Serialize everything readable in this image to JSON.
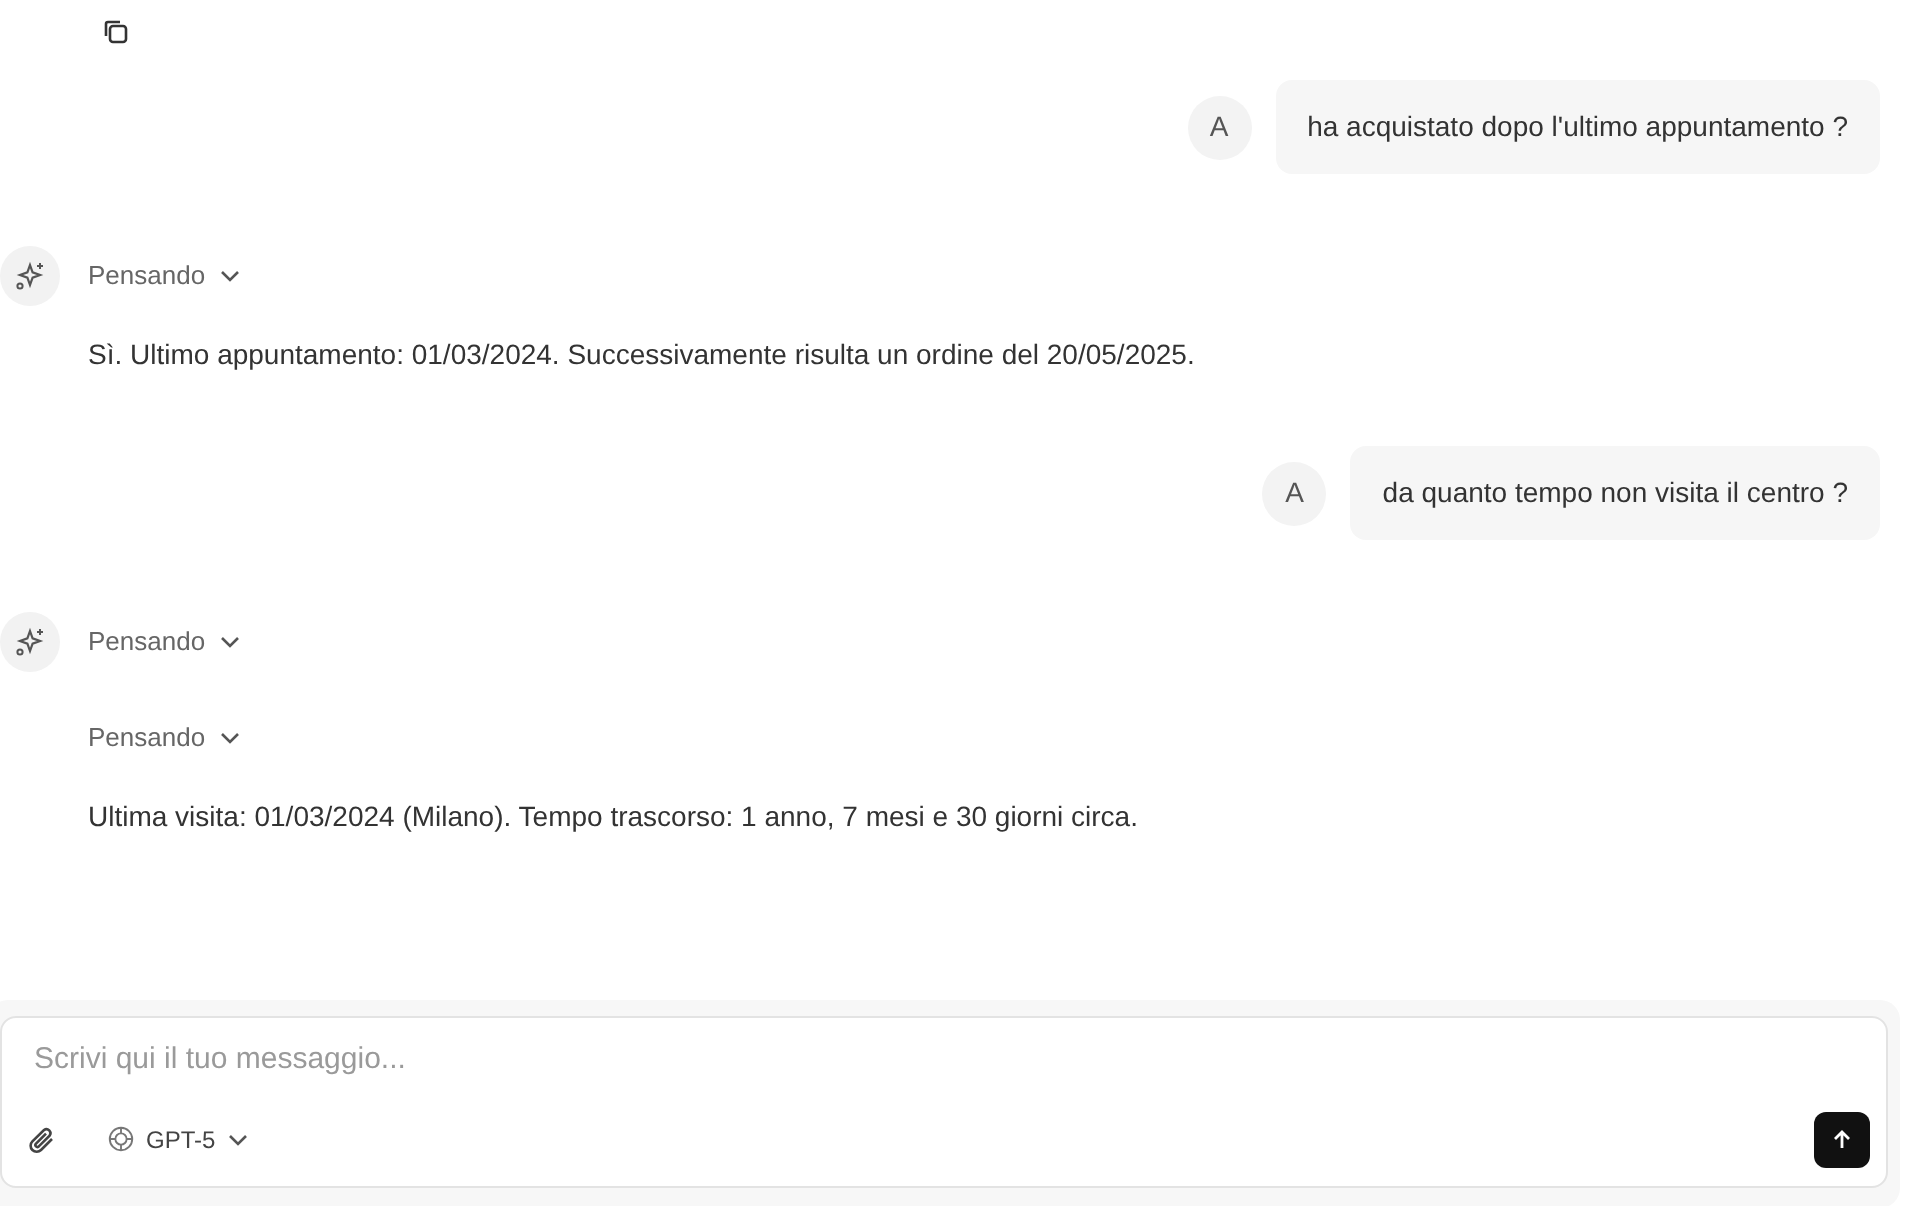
{
  "messages": [
    {
      "kind": "user",
      "avatar": "A",
      "text": "ha acquistato dopo l'ultimo appuntamento ?"
    },
    {
      "kind": "assistant",
      "thinking": [
        "Pensando"
      ],
      "text": "Sì. Ultimo appuntamento: 01/03/2024. Successivamente risulta un ordine del 20/05/2025."
    },
    {
      "kind": "user",
      "avatar": "A",
      "text": "da quanto tempo non visita il centro ?"
    },
    {
      "kind": "assistant",
      "thinking": [
        "Pensando",
        "Pensando"
      ],
      "text": "Ultima visita: 01/03/2024 (Milano). Tempo trascorso: 1 anno, 7 mesi e 30 giorni circa."
    }
  ],
  "composer": {
    "placeholder": "Scrivi qui il tuo messaggio...",
    "model": "GPT-5"
  }
}
